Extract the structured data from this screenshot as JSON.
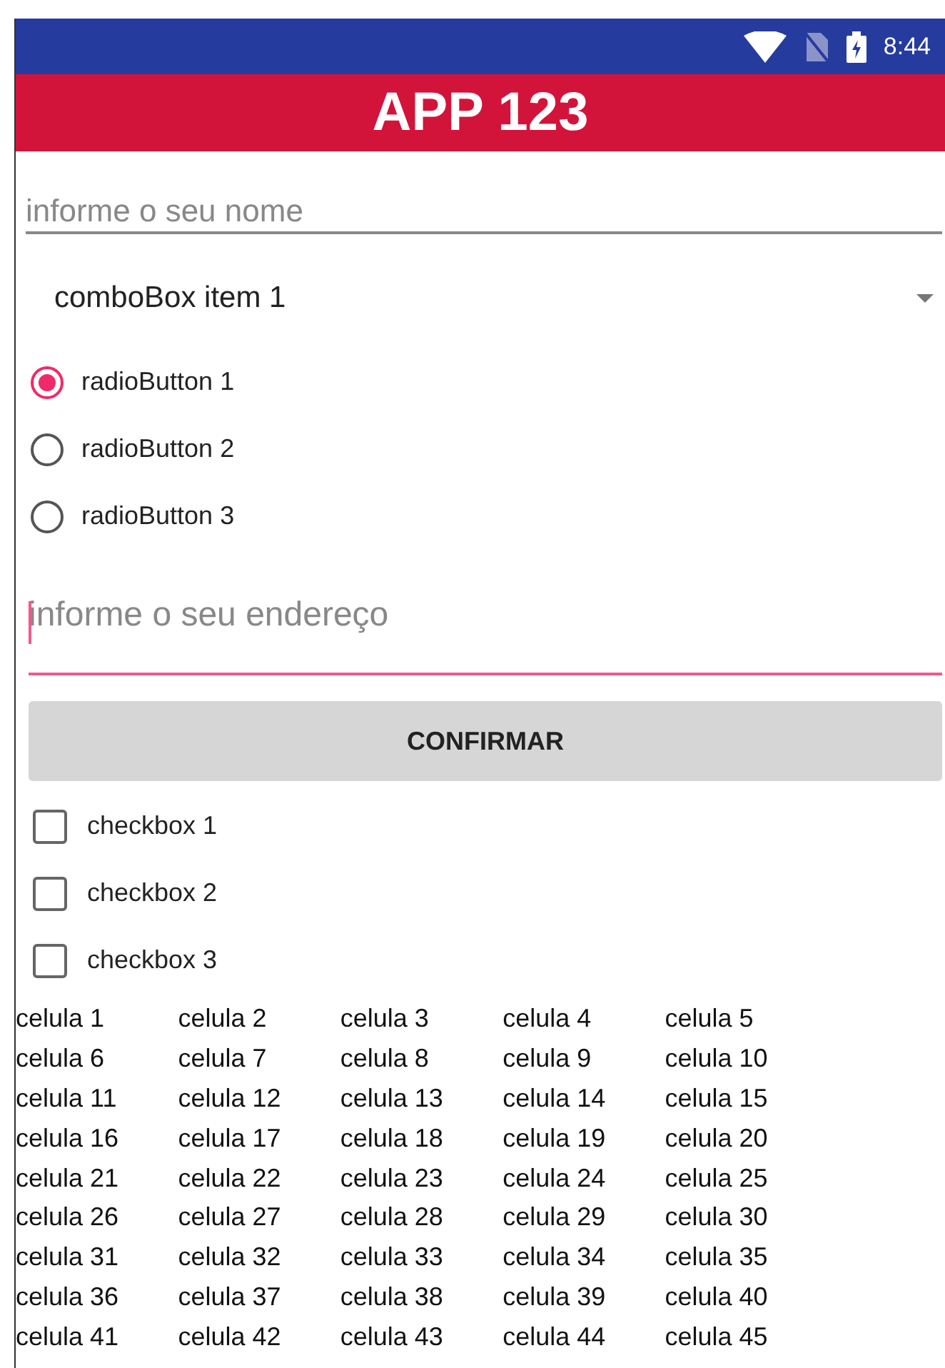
{
  "status_bar": {
    "time": "8:44"
  },
  "app_bar": {
    "title": "APP 123"
  },
  "name_field": {
    "placeholder": "informe o seu nome",
    "focused": false
  },
  "combo_box": {
    "value": "comboBox item 1"
  },
  "radios": [
    {
      "label": "radioButton 1",
      "selected": true
    },
    {
      "label": "radioButton 2",
      "selected": false
    },
    {
      "label": "radioButton 3",
      "selected": false
    }
  ],
  "address_field": {
    "placeholder": "informe o seu endereço",
    "focused": true
  },
  "confirm_button": {
    "label": "CONFIRMAR"
  },
  "checkboxes": [
    {
      "label": "checkbox 1",
      "checked": false
    },
    {
      "label": "checkbox 2",
      "checked": false
    },
    {
      "label": "checkbox 3",
      "checked": false
    }
  ],
  "table": {
    "rows": [
      [
        "celula 1",
        "celula 2",
        "celula 3",
        "celula 4",
        "celula 5"
      ],
      [
        "celula 6",
        "celula 7",
        "celula 8",
        "celula 9",
        "celula 10"
      ],
      [
        "celula 11",
        "celula 12",
        "celula 13",
        "celula 14",
        "celula 15"
      ],
      [
        "celula 16",
        "celula 17",
        "celula 18",
        "celula 19",
        "celula 20"
      ],
      [
        "celula 21",
        "celula 22",
        "celula 23",
        "celula 24",
        "celula 25"
      ],
      [
        "celula 26",
        "celula 27",
        "celula 28",
        "celula 29",
        "celula 30"
      ],
      [
        "celula 31",
        "celula 32",
        "celula 33",
        "celula 34",
        "celula 35"
      ],
      [
        "celula 36",
        "celula 37",
        "celula 38",
        "celula 39",
        "celula 40"
      ],
      [
        "celula 41",
        "celula 42",
        "celula 43",
        "celula 44",
        "celula 45"
      ]
    ]
  }
}
